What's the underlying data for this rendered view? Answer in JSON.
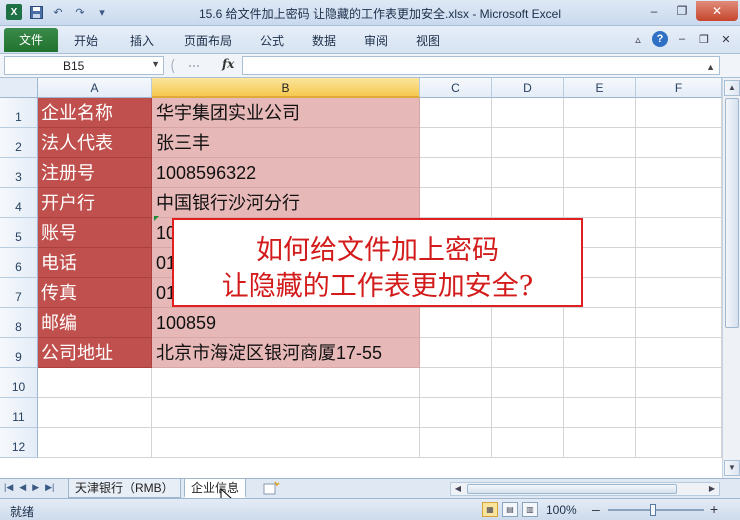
{
  "window": {
    "title": "15.6 给文件加上密码 让隐藏的工作表更加安全.xlsx - Microsoft Excel",
    "controls": {
      "minimize": "–",
      "restore": "❐",
      "close": "✕"
    }
  },
  "ribbon": {
    "tabs": [
      {
        "label": "文件"
      },
      {
        "label": "开始"
      },
      {
        "label": "插入"
      },
      {
        "label": "页面布局"
      },
      {
        "label": "公式"
      },
      {
        "label": "数据"
      },
      {
        "label": "审阅"
      },
      {
        "label": "视图"
      }
    ]
  },
  "formula_bar": {
    "name_box": "B15",
    "fx_label": "fx",
    "value": ""
  },
  "columns": [
    "A",
    "B",
    "C",
    "D",
    "E",
    "F"
  ],
  "rows": [
    "1",
    "2",
    "3",
    "4",
    "5",
    "6",
    "7",
    "8",
    "9",
    "10",
    "11",
    "12"
  ],
  "cells": [
    {
      "a": "企业名称",
      "b": "华宇集团实业公司"
    },
    {
      "a": "法人代表",
      "b": "张三丰"
    },
    {
      "a": "注册号",
      "b": "1008596322"
    },
    {
      "a": "开户行",
      "b": "中国银行沙河分行"
    },
    {
      "a": "账号",
      "b": "10"
    },
    {
      "a": "电话",
      "b": "01"
    },
    {
      "a": "传真",
      "b": "01"
    },
    {
      "a": "邮编",
      "b": "100859"
    },
    {
      "a": "公司地址",
      "b": "北京市海淀区银河商厦17-55"
    }
  ],
  "banner": {
    "line1": "如何给文件加上密码",
    "line2": "让隐藏的工作表更加安全?"
  },
  "sheets": [
    {
      "label": "天津银行（RMB）",
      "active": false
    },
    {
      "label": "企业信息",
      "active": true
    }
  ],
  "status": {
    "mode": "就绪",
    "zoom": "100%"
  },
  "colors": {
    "label_fill": "#c0504d",
    "value_fill": "#e6b8b7",
    "banner_text": "#d41b1b"
  }
}
